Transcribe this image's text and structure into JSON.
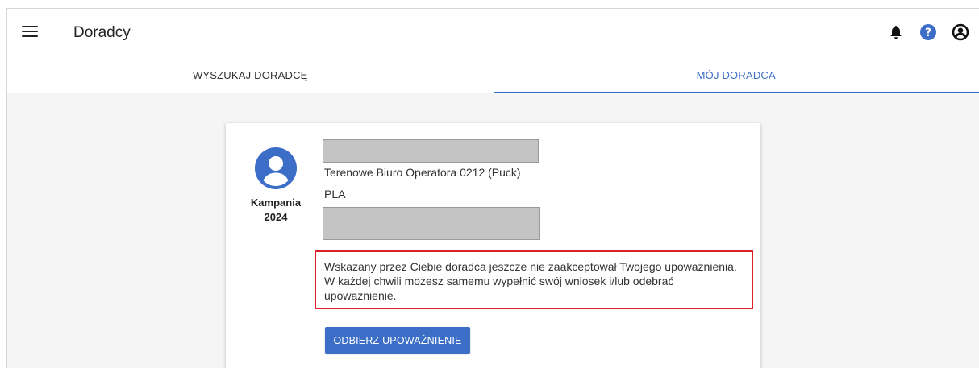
{
  "header": {
    "title": "Doradcy",
    "icons": [
      "menu-icon",
      "bell-icon",
      "help-icon",
      "user-icon"
    ]
  },
  "tabs": [
    {
      "label": "WYSZUKAJ DORADCĘ",
      "active": false
    },
    {
      "label": "MÓJ DORADCA",
      "active": true
    }
  ],
  "advisor": {
    "campaign": "Kampania 2024",
    "office": "Terenowe Biuro Operatora 0212 (Puck)",
    "country": "PLA",
    "notice": "Wskazany przez Ciebie doradca jeszcze nie zaakceptował Twojego upoważnienia. W każdej chwili możesz samemu wypełnić swój wniosek i/lub odebrać upoważnienie.",
    "revoke_label": "ODBIERZ UPOWAŻNIENIE"
  },
  "colors": {
    "accent": "#3c6ec7",
    "notice_border": "#d9202a"
  }
}
